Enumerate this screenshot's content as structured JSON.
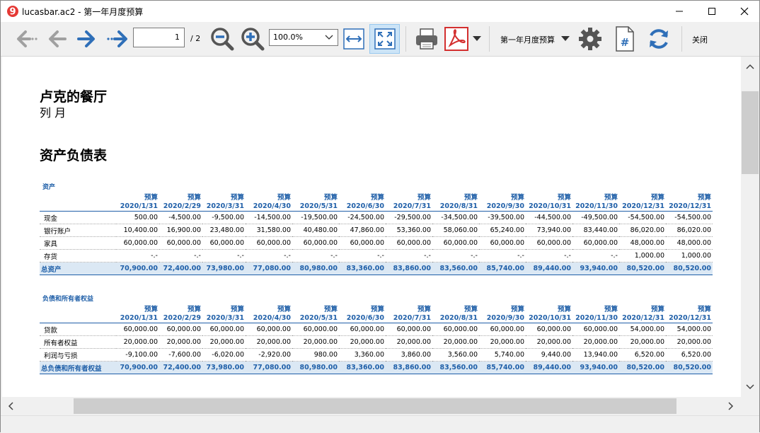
{
  "window": {
    "title": "lucasbar.ac2 - 第一年月度预算"
  },
  "toolbar": {
    "page_number": "1",
    "page_total": "/ 2",
    "zoom_value": "100.0%",
    "period_label": "第一年月度预算",
    "close_label": "关闭"
  },
  "colors": {
    "accent": "#1f5fa8",
    "total_row_bg": "#dbe8f4",
    "arrow_blue": "#2f6fb8",
    "pdf_red": "#d32f2f",
    "app_icon_red": "#e53935"
  },
  "icons": [
    "back-first-icon",
    "back-icon",
    "forward-icon",
    "forward-last-icon",
    "zoom-out-icon",
    "zoom-in-icon",
    "fit-width-icon",
    "fit-page-icon",
    "print-icon",
    "pdf-icon",
    "dropdown-icon",
    "settings-icon",
    "page-number-icon",
    "refresh-icon"
  ],
  "report": {
    "company": "卢克的餐厅",
    "subtitle": "列 月",
    "title": "资产负债表",
    "budget_label": "预算",
    "dates": [
      "2020/1/31",
      "2020/2/29",
      "2020/3/31",
      "2020/4/30",
      "2020/5/31",
      "2020/6/30",
      "2020/7/31",
      "2020/8/31",
      "2020/9/30",
      "2020/10/31",
      "2020/11/30",
      "2020/12/31",
      "2020/12/31"
    ],
    "sections": [
      {
        "title": "资产",
        "rows": [
          {
            "label": "现金",
            "values": [
              "500.00",
              "-4,500.00",
              "-9,500.00",
              "-14,500.00",
              "-19,500.00",
              "-24,500.00",
              "-29,500.00",
              "-34,500.00",
              "-39,500.00",
              "-44,500.00",
              "-49,500.00",
              "-54,500.00",
              "-54,500.00"
            ]
          },
          {
            "label": "银行账户",
            "values": [
              "10,400.00",
              "16,900.00",
              "23,480.00",
              "31,580.00",
              "40,480.00",
              "47,860.00",
              "53,360.00",
              "58,060.00",
              "65,240.00",
              "73,940.00",
              "83,440.00",
              "86,020.00",
              "86,020.00"
            ]
          },
          {
            "label": "家具",
            "values": [
              "60,000.00",
              "60,000.00",
              "60,000.00",
              "60,000.00",
              "60,000.00",
              "60,000.00",
              "60,000.00",
              "60,000.00",
              "60,000.00",
              "60,000.00",
              "60,000.00",
              "48,000.00",
              "48,000.00"
            ]
          },
          {
            "label": "存货",
            "values": [
              "-.-",
              "-.-",
              "-.-",
              "-.-",
              "-.-",
              "-.-",
              "-.-",
              "-.-",
              "-.-",
              "-.-",
              "-.-",
              "1,000.00",
              "1,000.00"
            ]
          }
        ],
        "total": {
          "label": "总资产",
          "values": [
            "70,900.00",
            "72,400.00",
            "73,980.00",
            "77,080.00",
            "80,980.00",
            "83,360.00",
            "83,860.00",
            "83,560.00",
            "85,740.00",
            "89,440.00",
            "93,940.00",
            "80,520.00",
            "80,520.00"
          ]
        }
      },
      {
        "title": "负债和所有者权益",
        "rows": [
          {
            "label": "贷款",
            "values": [
              "60,000.00",
              "60,000.00",
              "60,000.00",
              "60,000.00",
              "60,000.00",
              "60,000.00",
              "60,000.00",
              "60,000.00",
              "60,000.00",
              "60,000.00",
              "60,000.00",
              "54,000.00",
              "54,000.00"
            ]
          },
          {
            "label": "所有者权益",
            "values": [
              "20,000.00",
              "20,000.00",
              "20,000.00",
              "20,000.00",
              "20,000.00",
              "20,000.00",
              "20,000.00",
              "20,000.00",
              "20,000.00",
              "20,000.00",
              "20,000.00",
              "20,000.00",
              "20,000.00"
            ]
          },
          {
            "label": "利润与亏损",
            "values": [
              "-9,100.00",
              "-7,600.00",
              "-6,020.00",
              "-2,920.00",
              "980.00",
              "3,360.00",
              "3,860.00",
              "3,560.00",
              "5,740.00",
              "9,440.00",
              "13,940.00",
              "6,520.00",
              "6,520.00"
            ]
          }
        ],
        "total": {
          "label": "总负债和所有者权益",
          "values": [
            "70,900.00",
            "72,400.00",
            "73,980.00",
            "77,080.00",
            "80,980.00",
            "83,360.00",
            "83,860.00",
            "83,560.00",
            "85,740.00",
            "89,440.00",
            "93,940.00",
            "80,520.00",
            "80,520.00"
          ]
        }
      }
    ]
  }
}
